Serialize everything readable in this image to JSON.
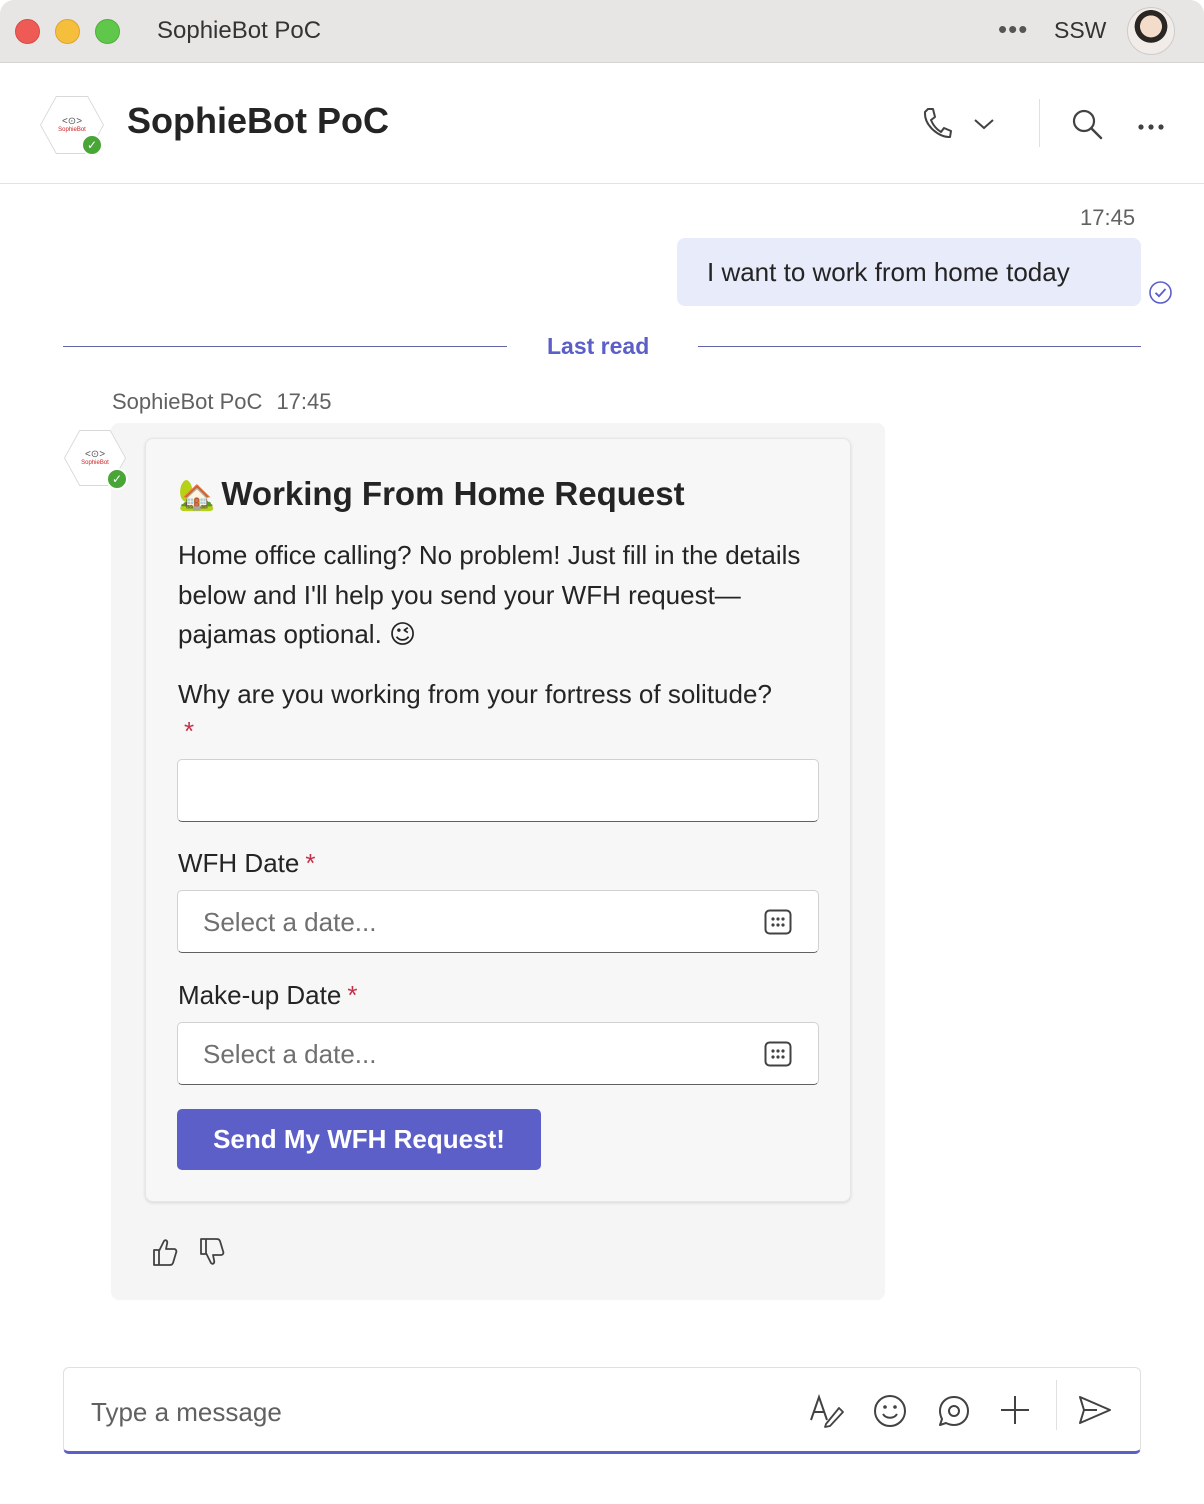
{
  "window": {
    "title": "SophieBot PoC",
    "org": "SSW",
    "more_label": "•••"
  },
  "header": {
    "chat_title": "SophieBot PoC",
    "bot_logo_text": "SophieBot",
    "bot_logo_glyph": "<⊙>"
  },
  "messages": {
    "user_time": "17:45",
    "user_text": "I want to work from home today",
    "last_read": "Last read",
    "bot_sender": "SophieBot PoC",
    "bot_time": "17:45"
  },
  "card": {
    "emoji": "🏡",
    "title": "Working From Home Request",
    "description": "Home office calling? No problem! Just fill in the details below and I'll help you send your WFH request—pajamas optional. 😉",
    "reason_label": "Why are you working from your fortress of solitude?",
    "reason_value": "",
    "wfh_date_label": "WFH Date",
    "wfh_date_placeholder": "Select a date...",
    "makeup_date_label": "Make-up Date",
    "makeup_date_placeholder": "Select a date...",
    "required_mark": "*",
    "submit_label": "Send My WFH Request!"
  },
  "compose": {
    "placeholder": "Type a message"
  },
  "colors": {
    "accent": "#5b5fc7",
    "my_bubble": "#e8ebfa",
    "required": "#c4314b",
    "status_green": "#4aa538"
  }
}
